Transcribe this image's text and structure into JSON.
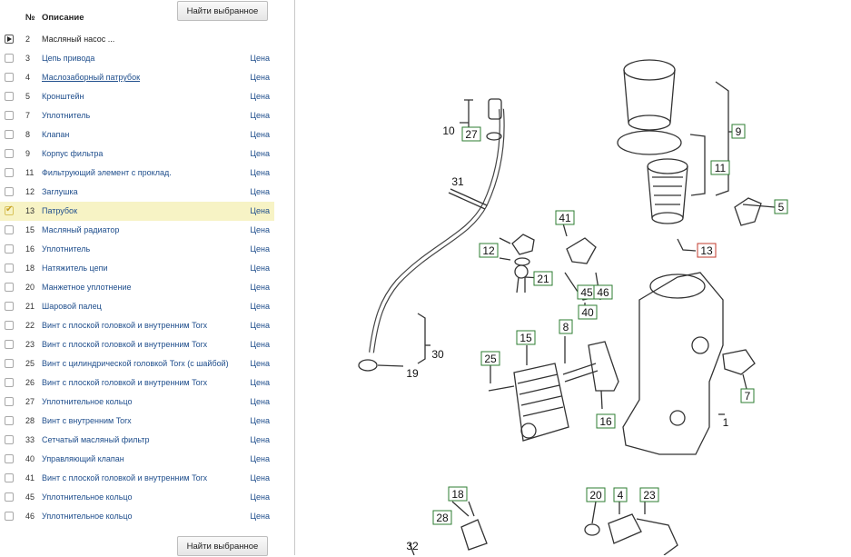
{
  "buttons": {
    "find_selected": "Найти выбранное"
  },
  "header": {
    "num": "№",
    "desc": "Описание"
  },
  "price_label": "Цена",
  "rows": [
    {
      "num": "2",
      "desc": "Масляный насос ...",
      "price": ""
    },
    {
      "num": "3",
      "desc": "Цепь привода",
      "price": "Цена"
    },
    {
      "num": "4",
      "desc": "Маслозаборный патрубок",
      "price": "Цена"
    },
    {
      "num": "5",
      "desc": "Кронштейн",
      "price": "Цена"
    },
    {
      "num": "7",
      "desc": "Уплотнитель",
      "price": "Цена"
    },
    {
      "num": "8",
      "desc": "Клапан",
      "price": "Цена"
    },
    {
      "num": "9",
      "desc": "Корпус фильтра",
      "price": "Цена"
    },
    {
      "num": "11",
      "desc": "Фильтрующий элемент с проклад.",
      "price": "Цена"
    },
    {
      "num": "12",
      "desc": "Заглушка",
      "price": "Цена"
    },
    {
      "num": "13",
      "desc": "Патрубок",
      "price": "Цена",
      "selected": true
    },
    {
      "num": "15",
      "desc": "Масляный радиатор",
      "price": "Цена"
    },
    {
      "num": "16",
      "desc": "Уплотнитель",
      "price": "Цена"
    },
    {
      "num": "18",
      "desc": "Натяжитель цепи",
      "price": "Цена"
    },
    {
      "num": "20",
      "desc": "Манжетное уплотнение",
      "price": "Цена"
    },
    {
      "num": "21",
      "desc": "Шаровой палец",
      "price": "Цена"
    },
    {
      "num": "22",
      "desc": "Винт с плоской головкой и внутренним Torx",
      "price": "Цена"
    },
    {
      "num": "23",
      "desc": "Винт с плоской головкой и внутренним Torx",
      "price": "Цена"
    },
    {
      "num": "25",
      "desc": "Винт с цилиндрической головкой Torx (с шайбой)",
      "price": "Цена"
    },
    {
      "num": "26",
      "desc": "Винт с плоской головкой и внутренним Torx",
      "price": "Цена"
    },
    {
      "num": "27",
      "desc": "Уплотнительное кольцо",
      "price": "Цена"
    },
    {
      "num": "28",
      "desc": "Винт с внутренним Torx",
      "price": "Цена"
    },
    {
      "num": "33",
      "desc": "Сетчатый масляный фильтр",
      "price": "Цена"
    },
    {
      "num": "40",
      "desc": "Управляющий клапан",
      "price": "Цена"
    },
    {
      "num": "41",
      "desc": "Винт с плоской головкой и внутренним Torx",
      "price": "Цена"
    },
    {
      "num": "45",
      "desc": "Уплотнительное кольцо",
      "price": "Цена"
    },
    {
      "num": "46",
      "desc": "Уплотнительное кольцо",
      "price": "Цена"
    }
  ],
  "callouts": [
    "10",
    "27",
    "31",
    "9",
    "11",
    "5",
    "41",
    "13",
    "12",
    "21",
    "45",
    "46",
    "40",
    "30",
    "19",
    "8",
    "15",
    "25",
    "16",
    "7",
    "1",
    "18",
    "28",
    "32",
    "20",
    "4",
    "23"
  ]
}
